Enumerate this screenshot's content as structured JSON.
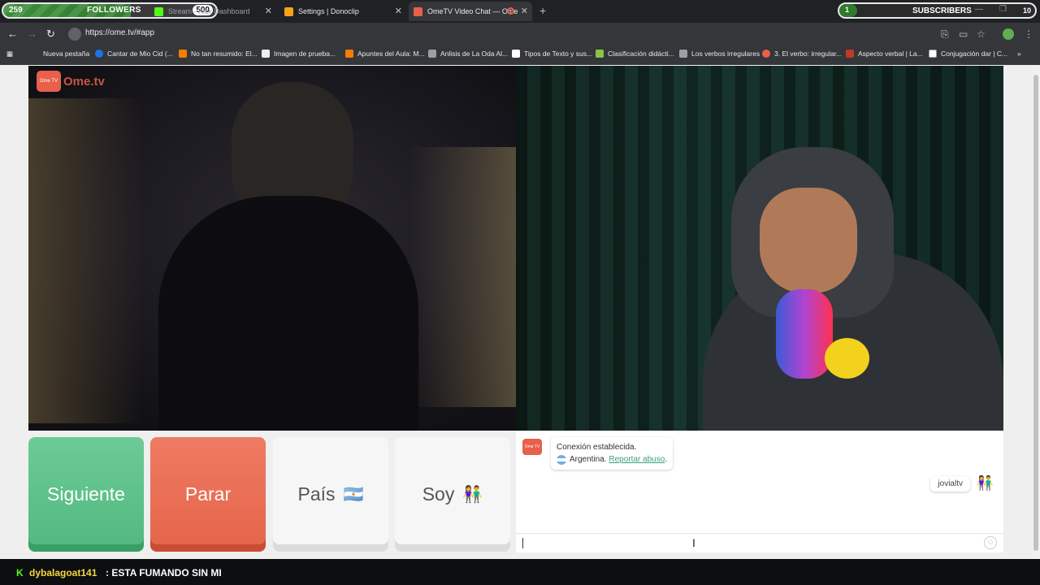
{
  "overlay": {
    "followers": {
      "count": "259",
      "label": "FOLLOWERS",
      "goal": "500",
      "progress": 0.52
    },
    "subscribers": {
      "count": "1",
      "label": "SUBSCRIBERS",
      "goal": "10",
      "progress": 0.1
    }
  },
  "tabs": [
    {
      "title": "Stream - Kick Dashboard",
      "active": false
    },
    {
      "title": "Settings | Donoclip",
      "active": false
    },
    {
      "title": "OmeTV Video Chat — Ome",
      "active": true
    }
  ],
  "browser": {
    "url": "https://ome.tv/#app",
    "bookmarks": [
      "Nueva pestaña",
      "Cantar de Mio Cid (...",
      "No tan resumido: El...",
      "Imagen de prueba...",
      "Apuntes del Aula: M...",
      "Anlisis de La Oda Al...",
      "Tipos de Texto y sus...",
      "Clasificación didácti...",
      "Los verbos irregulares",
      "3. El verbo: irregular...",
      "Aspecto verbal | La...",
      "Conjugación dar | C..."
    ]
  },
  "app": {
    "logo_text": "Ome.tv",
    "logo_badge": "Ome TV",
    "buttons": {
      "next": "Siguiente",
      "stop": "Parar",
      "country": "País",
      "gender": "Soy"
    },
    "chat": {
      "status": "Conexión establecida.",
      "country": "Argentina.",
      "report": "Reportar abuso",
      "own_name": "jovialtv"
    }
  },
  "ticker": {
    "user": "dybalagoat141",
    "message": ": ESTA FUMANDO SIN MI"
  },
  "colors": {
    "next": "#5cc08a",
    "stop": "#e96f55",
    "brand": "#e8604a",
    "kick": "#53fc18"
  }
}
